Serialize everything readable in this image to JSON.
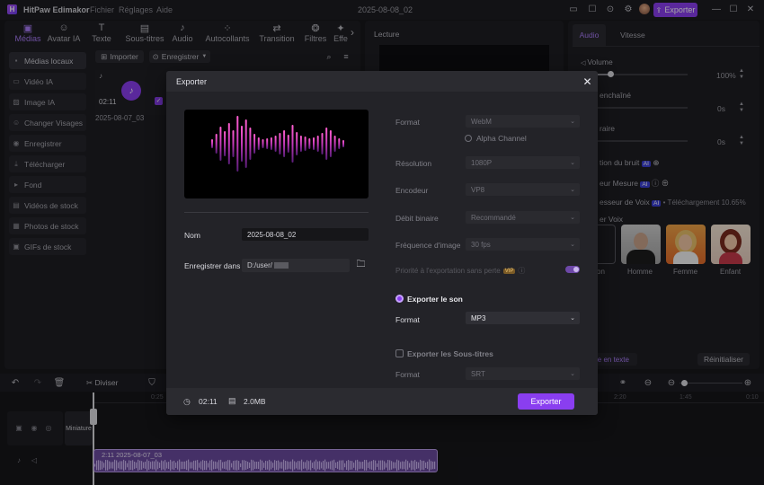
{
  "app": {
    "title": "HitPaw Edimakor",
    "menu": [
      "Fichier",
      "Réglages",
      "Aide"
    ],
    "project_name": "2025-08-08_02",
    "export_label": "Exporter"
  },
  "toolbar": {
    "items": [
      "Médias",
      "Avatar IA",
      "Texte",
      "Sous-titres",
      "Audio",
      "Autocollants",
      "Transition",
      "Filtres",
      "Effe"
    ]
  },
  "sidebar": {
    "items": [
      "Médias locaux",
      "Vidéo IA",
      "Image IA",
      "Changer Visages",
      "Enregistrer",
      "Télécharger",
      "Fond",
      "Vidéos de stock",
      "Photos de stock",
      "GIFs de stock"
    ]
  },
  "media": {
    "import_label": "Importer",
    "record_label": "Enregistrer",
    "duration": "02:11",
    "name": "2025-08-07_03"
  },
  "preview": {
    "title": "Lecture"
  },
  "right_panel": {
    "tabs": [
      "Audio",
      "Vitesse"
    ],
    "volume_label": "Volume",
    "volume_value": "100%",
    "volume_level": 1.0,
    "fade_in_label": "enchaîné",
    "fade_in_value": "0s",
    "fade_out_label": "raire",
    "fade_out_value": "0s",
    "noise_label": "tion du bruit",
    "meter_label": "eur Mesure",
    "voice_changer_label": "esseur de Voix",
    "download_text": "• Téléchargement 10.65%",
    "voice_label": "er Voix",
    "voices": [
      "on",
      "Homme",
      "Femme",
      "Enfant"
    ],
    "text_btn": "le en texte",
    "reset_btn": "Réinitialiser"
  },
  "timeline": {
    "split_label": "Diviser",
    "ruler": [
      "0:25",
      "2:20",
      "1:45",
      "0:10"
    ],
    "track_label": "Miniature",
    "clip_label": "2:11 2025-08-07_03"
  },
  "export": {
    "title": "Exporter",
    "name_label": "Nom",
    "name_value": "2025-08-08_02",
    "save_label": "Enregistrer dans",
    "save_path": "D:/user/",
    "format_label": "Format",
    "format_value": "WebM",
    "alpha_label": "Alpha Channel",
    "resolution_label": "Résolution",
    "resolution_value": "1080P",
    "encoder_label": "Encodeur",
    "encoder_value": "VP8",
    "bitrate_label": "Débit binaire",
    "bitrate_value": "Recommandé",
    "fps_label": "Fréquence d'image",
    "fps_value": "30  fps",
    "lossless_label": "Priorité à l'exportation sans perte",
    "vip": "VIP",
    "export_audio_label": "Exporter le son",
    "audio_format_label": "Format",
    "audio_format_value": "MP3",
    "subtitles_label": "Exporter les Sous-titres",
    "sub_format_label": "Format",
    "sub_format_value": "SRT",
    "duration": "02:11",
    "size": "2.0MB",
    "export_btn": "Exporter"
  },
  "colors": {
    "accent": "#8a3ef0",
    "accent_light": "#a97cf7"
  }
}
